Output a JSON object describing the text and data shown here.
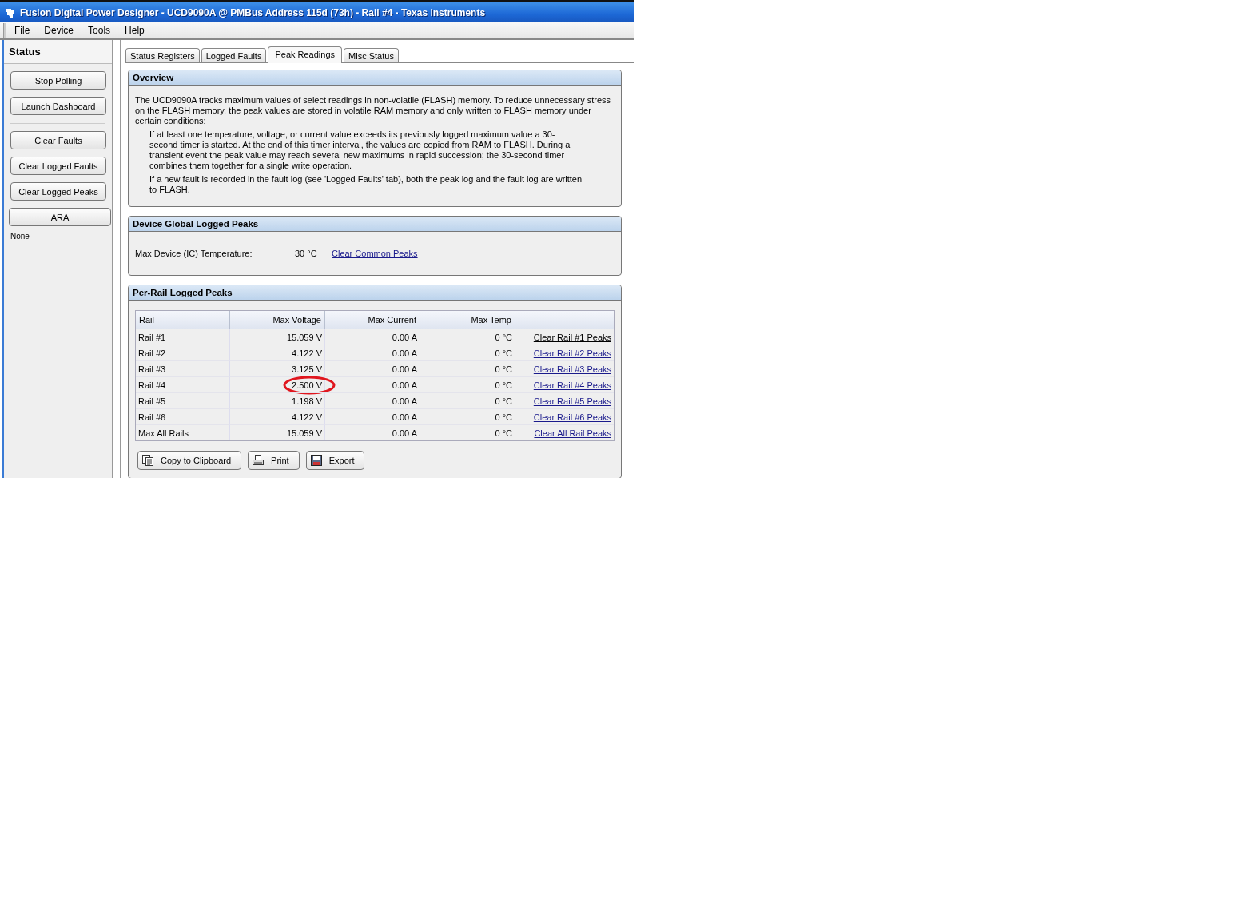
{
  "window": {
    "title": "Fusion Digital Power Designer - UCD9090A @ PMBus Address 115d (73h) - Rail #4 - Texas Instruments"
  },
  "menu": [
    "File",
    "Device",
    "Tools",
    "Help"
  ],
  "sidebar": {
    "title": "Status",
    "button_groups": [
      [
        "Stop Polling",
        "Launch Dashboard"
      ],
      [
        "Clear Faults",
        "Clear Logged Faults",
        "Clear Logged Peaks"
      ]
    ],
    "ara": {
      "label": "ARA"
    },
    "ara_status": {
      "name": "None",
      "value": "---"
    }
  },
  "tabs": [
    {
      "label": "Status Registers",
      "selected": false
    },
    {
      "label": "Logged Faults",
      "selected": false
    },
    {
      "label": "Peak Readings",
      "selected": true
    },
    {
      "label": "Misc Status",
      "selected": false
    }
  ],
  "overview": {
    "title": "Overview",
    "intro": "The UCD9090A tracks maximum values of select readings in non-volatile (FLASH) memory. To reduce unnecessary stress on the FLASH memory, the peak values are stored in volatile RAM memory and only written to FLASH memory under certain conditions:",
    "points": [
      "If at least one temperature, voltage, or current value exceeds its previously logged maximum value a 30-second timer is started.  At the end of this timer interval, the values are copied from RAM to FLASH.  During a transient event the peak value may reach several new maximums in rapid succession; the 30-second timer combines them together for a single write operation.",
      "If a new fault is recorded in the fault log (see 'Logged Faults' tab), both the peak log and the fault log are written to FLASH."
    ]
  },
  "global_peaks": {
    "title": "Device Global Logged Peaks",
    "label": "Max Device (IC) Temperature:",
    "value": "30 °C",
    "link": "Clear Common Peaks"
  },
  "per_rail": {
    "title": "Per-Rail Logged Peaks",
    "columns": [
      "Rail",
      "Max Voltage",
      "Max Current",
      "Max Temp"
    ],
    "rows": [
      {
        "rail": "Rail #1",
        "voltage": "15.059 V",
        "current": "0.00 A",
        "temp": "0 °C",
        "link": "Clear Rail #1 Peaks",
        "hovered": true,
        "circled": false
      },
      {
        "rail": "Rail #2",
        "voltage": "4.122 V",
        "current": "0.00 A",
        "temp": "0 °C",
        "link": "Clear Rail #2 Peaks",
        "hovered": false,
        "circled": false
      },
      {
        "rail": "Rail #3",
        "voltage": "3.125 V",
        "current": "0.00 A",
        "temp": "0 °C",
        "link": "Clear Rail #3 Peaks",
        "hovered": false,
        "circled": false
      },
      {
        "rail": "Rail #4",
        "voltage": "2.500 V",
        "current": "0.00 A",
        "temp": "0 °C",
        "link": "Clear Rail #4 Peaks",
        "hovered": false,
        "circled": true
      },
      {
        "rail": "Rail #5",
        "voltage": "1.198 V",
        "current": "0.00 A",
        "temp": "0 °C",
        "link": "Clear Rail #5 Peaks",
        "hovered": false,
        "circled": false
      },
      {
        "rail": "Rail #6",
        "voltage": "4.122 V",
        "current": "0.00 A",
        "temp": "0 °C",
        "link": "Clear Rail #6 Peaks",
        "hovered": false,
        "circled": false
      },
      {
        "rail": "Max All Rails",
        "voltage": "15.059 V",
        "current": "0.00 A",
        "temp": "0 °C",
        "link": "Clear All Rail Peaks",
        "hovered": false,
        "circled": false
      }
    ],
    "buttons": [
      "Copy to Clipboard",
      "Print",
      "Export"
    ]
  }
}
